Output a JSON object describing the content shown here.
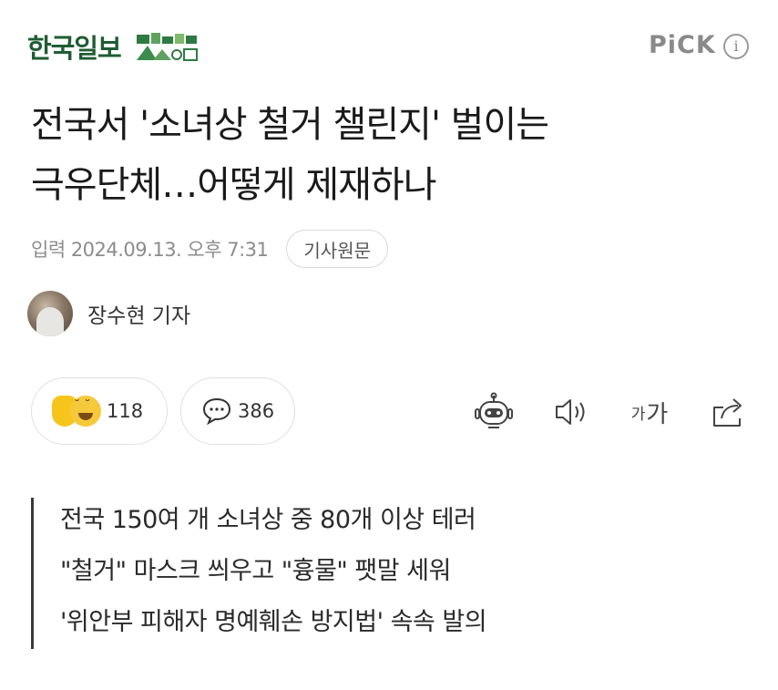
{
  "header": {
    "brand": "한국일보",
    "pick_label": "PiCK",
    "info_icon": "info-icon"
  },
  "article": {
    "title_line1": "전국서 '소녀상 철거 챌린지' 벌이는",
    "title_line2": "극우단체…어떻게 제재하나",
    "date": "입력 2024.09.13. 오후 7:31",
    "origin_button": "기사원문",
    "reporter": "장수현 기자"
  },
  "reactions": {
    "like_count": "118",
    "comment_count": "386",
    "font_small": "가",
    "font_large": "가"
  },
  "summary": [
    "전국 150여 개 소녀상 중 80개 이상 테러",
    "\"철거\" 마스크 씌우고 \"흉물\" 팻말 세워",
    "'위안부 피해자 명예훼손 방지법' 속속 발의"
  ],
  "colors": {
    "brand_green": "#1f5c33",
    "pick_gray": "#8a8a8a",
    "emoji_yellow": "#f5c51b"
  }
}
